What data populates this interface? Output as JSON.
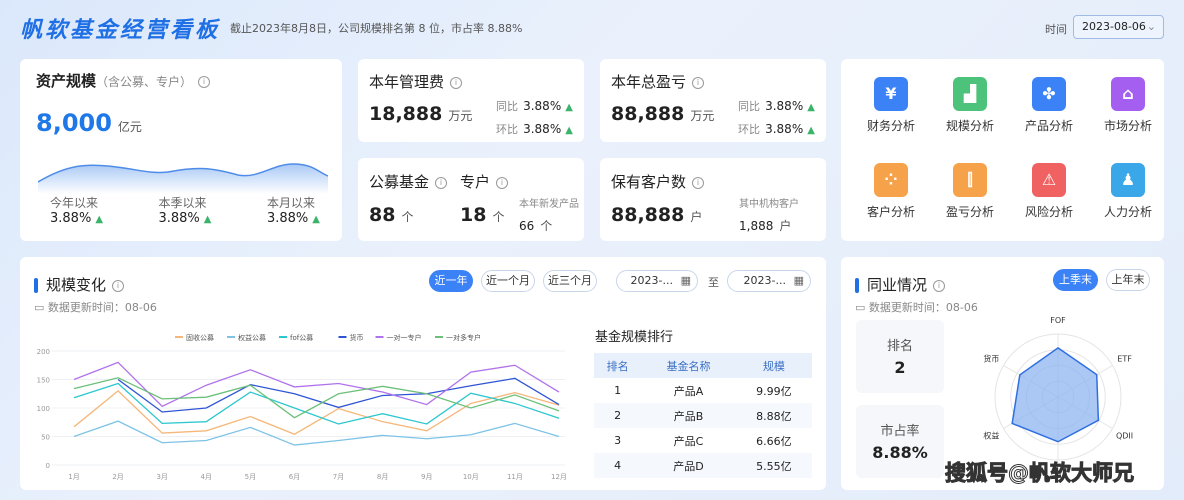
{
  "header": {
    "title": "帆软基金经营看板",
    "subtitle": "截止2023年8月8日，公司规模排名第 8 位，市占率 8.88%",
    "time_label": "时间",
    "date_value": "2023-08-06"
  },
  "asset": {
    "title": "资产规模",
    "note": "（含公募、专户）",
    "value": "8,000",
    "unit": "亿元",
    "stats": [
      {
        "label": "今年以来",
        "value": "3.88%"
      },
      {
        "label": "本季以来",
        "value": "3.88%"
      },
      {
        "label": "本月以来",
        "value": "3.88%"
      }
    ]
  },
  "fee": {
    "title": "本年管理费",
    "value": "18,888",
    "unit": "万元",
    "yoy_label": "同比",
    "yoy": "3.88%",
    "mom_label": "环比",
    "mom": "3.88%"
  },
  "funds": {
    "public_title": "公募基金",
    "public_value": "88",
    "public_unit": "个",
    "special_title": "专户",
    "special_value": "18",
    "special_unit": "个",
    "new_label": "本年新发产品",
    "new_value": "66",
    "new_unit": "个"
  },
  "profit": {
    "title": "本年总盈亏",
    "value": "88,888",
    "unit": "万元",
    "yoy_label": "同比",
    "yoy": "3.88%",
    "mom_label": "环比",
    "mom": "3.88%"
  },
  "clients": {
    "title": "保有客户数",
    "value": "88,888",
    "unit": "户",
    "inst_label": "其中机构客户",
    "inst_value": "1,888",
    "inst_unit": "户"
  },
  "nav": [
    {
      "label": "财务分析",
      "icon": "yen-icon",
      "color": "#3b82f6",
      "glyph": "¥"
    },
    {
      "label": "规模分析",
      "icon": "area-chart-icon",
      "color": "#4cc27a",
      "glyph": "▟"
    },
    {
      "label": "产品分析",
      "icon": "grid-icon",
      "color": "#3b82f6",
      "glyph": "✤"
    },
    {
      "label": "市场分析",
      "icon": "store-icon",
      "color": "#a45ff0",
      "glyph": "⌂"
    },
    {
      "label": "客户分析",
      "icon": "users-icon",
      "color": "#f6a24a",
      "glyph": "⁘"
    },
    {
      "label": "盈亏分析",
      "icon": "candlestick-icon",
      "color": "#f6a24a",
      "glyph": "⫿"
    },
    {
      "label": "风险分析",
      "icon": "warning-icon",
      "color": "#f06262",
      "glyph": "⚠"
    },
    {
      "label": "人力分析",
      "icon": "person-icon",
      "color": "#3aa8e8",
      "glyph": "♟"
    }
  ],
  "scale": {
    "title": "规模变化",
    "updated": "数据更新时间：08-06",
    "ranges": [
      "近一年",
      "近一个月",
      "近三个月"
    ],
    "date_from": "2023-...",
    "date_to": "2023-...",
    "to_label": "至"
  },
  "chart_data": {
    "type": "line",
    "categories": [
      "1月",
      "2月",
      "3月",
      "4月",
      "5月",
      "6月",
      "7月",
      "8月",
      "9月",
      "10月",
      "11月",
      "12月"
    ],
    "ylim": [
      0,
      200
    ],
    "yticks": [
      0,
      50,
      100,
      150,
      200
    ],
    "grid": true,
    "legend": "top",
    "series": [
      {
        "name": "固收公募",
        "color": "#f5b77a",
        "values": [
          67,
          130,
          56,
          60,
          85,
          54,
          99,
          76,
          60,
          108,
          127,
          105
        ]
      },
      {
        "name": "权益公募",
        "color": "#7ec3e6",
        "values": [
          50,
          77,
          39,
          43,
          66,
          35,
          43,
          52,
          46,
          53,
          73,
          50
        ]
      },
      {
        "name": "fof公募",
        "color": "#2cc7cf",
        "values": [
          118,
          143,
          73,
          76,
          128,
          100,
          72,
          90,
          72,
          126,
          108,
          82
        ]
      },
      {
        "name": "货币",
        "color": "#2f55d4",
        "values": [
          null,
          150,
          93,
          100,
          141,
          125,
          101,
          122,
          125,
          139,
          152,
          106
        ]
      },
      {
        "name": "一对一专户",
        "color": "#b072ec",
        "values": [
          150,
          180,
          103,
          140,
          167,
          137,
          143,
          128,
          106,
          163,
          175,
          128
        ]
      },
      {
        "name": "一对多专户",
        "color": "#6cc07a",
        "values": [
          134,
          153,
          116,
          119,
          140,
          83,
          125,
          138,
          125,
          100,
          123,
          95
        ]
      }
    ]
  },
  "ranking": {
    "title": "基金规模排行",
    "headers": [
      "排名",
      "基金名称",
      "规模"
    ],
    "rows": [
      [
        "1",
        "产品A",
        "9.99亿"
      ],
      [
        "2",
        "产品B",
        "8.88亿"
      ],
      [
        "3",
        "产品C",
        "6.66亿"
      ],
      [
        "4",
        "产品D",
        "5.55亿"
      ]
    ]
  },
  "industry": {
    "title": "同业情况",
    "updated": "数据更新时间：08-06",
    "tabs": [
      "上季末",
      "上年末"
    ],
    "rank_label": "排名",
    "rank_value": "2",
    "share_label": "市占率",
    "share_value": "8.88%",
    "radar": {
      "axes": [
        "FOF",
        "ETF",
        "QDII",
        "",
        "权益",
        "货币"
      ],
      "values": [
        0.78,
        0.71,
        0.74,
        0.71,
        0.84,
        0.7
      ],
      "color": "#2f6fe0"
    }
  },
  "watermark": "搜狐号@帆软大师兄"
}
